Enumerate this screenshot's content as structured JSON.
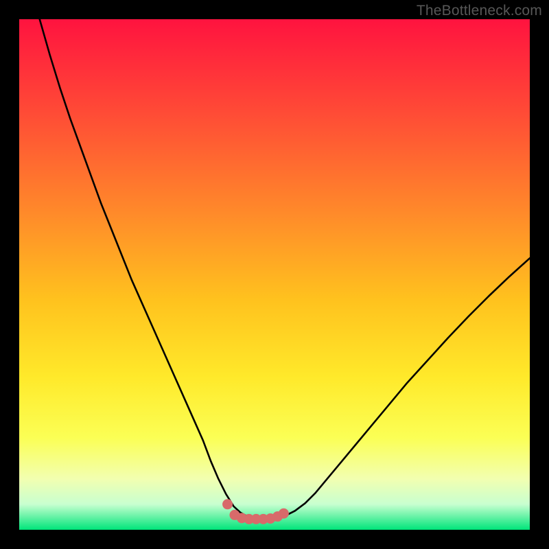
{
  "watermark": "TheBottleneck.com",
  "colors": {
    "frame": "#000000",
    "gradient_top": "#ff133f",
    "gradient_upper_mid": "#ff7d2a",
    "gradient_mid": "#ffe92a",
    "gradient_lower_mid": "#f8ff7a",
    "gradient_near_bottom": "#d8ffc8",
    "gradient_bottom": "#00e57a",
    "curve": "#000000",
    "markers": "#d86a6a"
  },
  "chart_data": {
    "type": "line",
    "title": "",
    "xlabel": "",
    "ylabel": "",
    "xlim": [
      0,
      100
    ],
    "ylim": [
      0,
      100
    ],
    "grid": false,
    "legend": false,
    "series": [
      {
        "name": "bottleneck-curve",
        "x": [
          4,
          6,
          8,
          10,
          12,
          14,
          16,
          18,
          20,
          22,
          24,
          26,
          28,
          30,
          32,
          34,
          36,
          37.5,
          39,
          40.5,
          42,
          43.3,
          44.7,
          46,
          47.3,
          48.7,
          50,
          52,
          54,
          56,
          58,
          60,
          63,
          66,
          69,
          72,
          76,
          80,
          84,
          88,
          92,
          96,
          100
        ],
        "y": [
          100,
          93,
          86.5,
          80.5,
          75,
          69.5,
          64,
          59,
          54,
          49,
          44.5,
          40,
          35.5,
          31,
          26.5,
          22,
          17.5,
          13.5,
          10,
          7,
          4.6,
          3.4,
          2.6,
          2.2,
          2.1,
          2.1,
          2.2,
          2.7,
          3.7,
          5.2,
          7.2,
          9.6,
          13.2,
          16.8,
          20.4,
          24,
          28.8,
          33.2,
          37.6,
          41.8,
          45.8,
          49.6,
          53.2
        ]
      }
    ],
    "markers": {
      "name": "valley-markers",
      "x": [
        40.8,
        42.2,
        43.6,
        45.0,
        46.4,
        47.8,
        49.2,
        50.6,
        51.8
      ],
      "y": [
        5.0,
        2.9,
        2.3,
        2.1,
        2.1,
        2.1,
        2.2,
        2.6,
        3.2
      ]
    }
  }
}
